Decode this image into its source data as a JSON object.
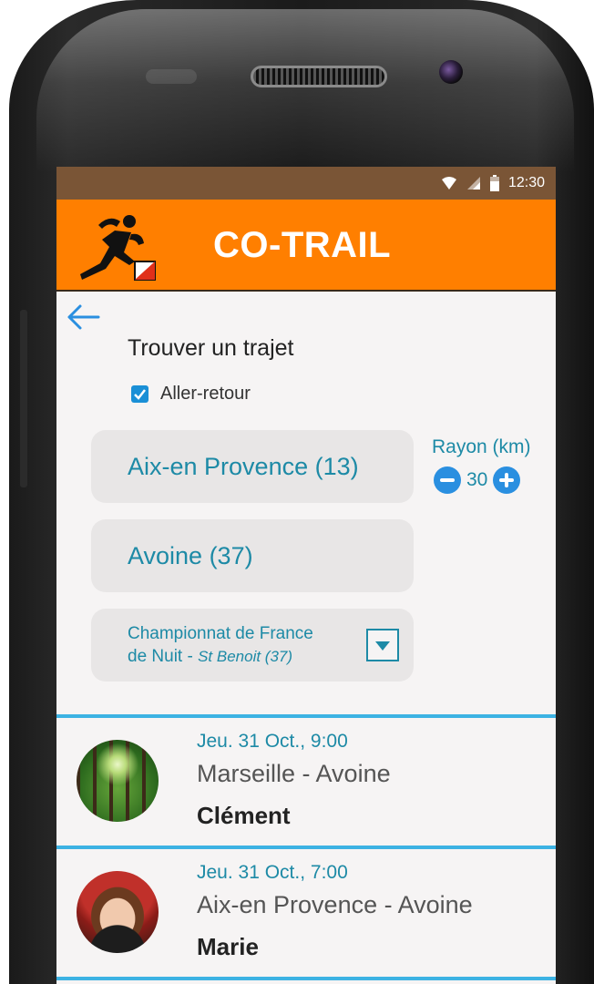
{
  "status_bar": {
    "time": "12:30"
  },
  "app": {
    "title": "CO-TRAIL"
  },
  "search": {
    "title": "Trouver un trajet",
    "round_trip_label": "Aller-retour",
    "round_trip_checked": true,
    "from": "Aix-en Provence (13)",
    "to": "Avoine (37)",
    "event_line1": "Championnat de France",
    "event_line2_prefix": "de Nuit - ",
    "event_line2_italic": "St Benoit (37)",
    "radius_label": "Rayon (km)",
    "radius_value": "30"
  },
  "results": [
    {
      "date": "Jeu. 31 Oct.,  9:00",
      "route": "Marseille - Avoine",
      "name": "Clément",
      "avatar": "forest-photo"
    },
    {
      "date": "Jeu. 31 Oct.,  7:00",
      "route": "Aix-en Provence - Avoine",
      "name": "Marie",
      "avatar": "woman-red-beret-photo"
    }
  ],
  "colors": {
    "app_bar": "#ff7f00",
    "status_bar": "#7a5536",
    "accent_text": "#1d8aa6",
    "separator": "#3cb2e3",
    "button_blue": "#2a8fe0"
  }
}
